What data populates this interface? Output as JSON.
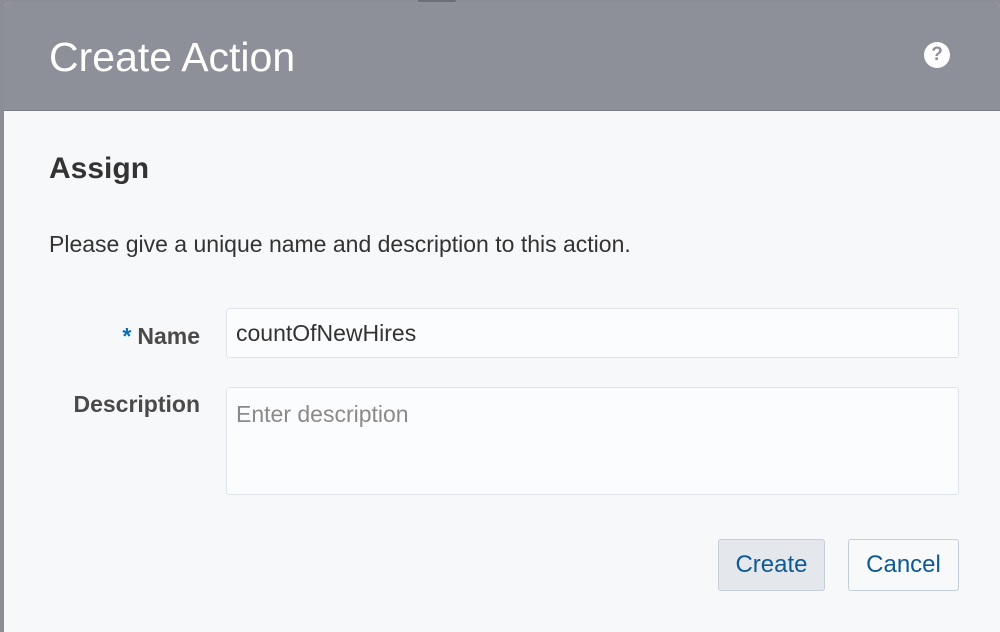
{
  "dialog": {
    "title": "Create Action",
    "help_icon": "question-mark-icon",
    "help_glyph": "?"
  },
  "section": {
    "title": "Assign",
    "instructions": "Please give a unique name and description to this action."
  },
  "form": {
    "name": {
      "required_marker": "*",
      "label": "Name",
      "value": "countOfNewHires"
    },
    "description": {
      "label": "Description",
      "value": "",
      "placeholder": "Enter description"
    }
  },
  "buttons": {
    "create_label": "Create",
    "cancel_label": "Cancel"
  },
  "colors": {
    "header_background": "#8e9099",
    "body_background": "#f7f8fa",
    "accent": "#0a6eb4",
    "button_text": "#0e5a92"
  }
}
